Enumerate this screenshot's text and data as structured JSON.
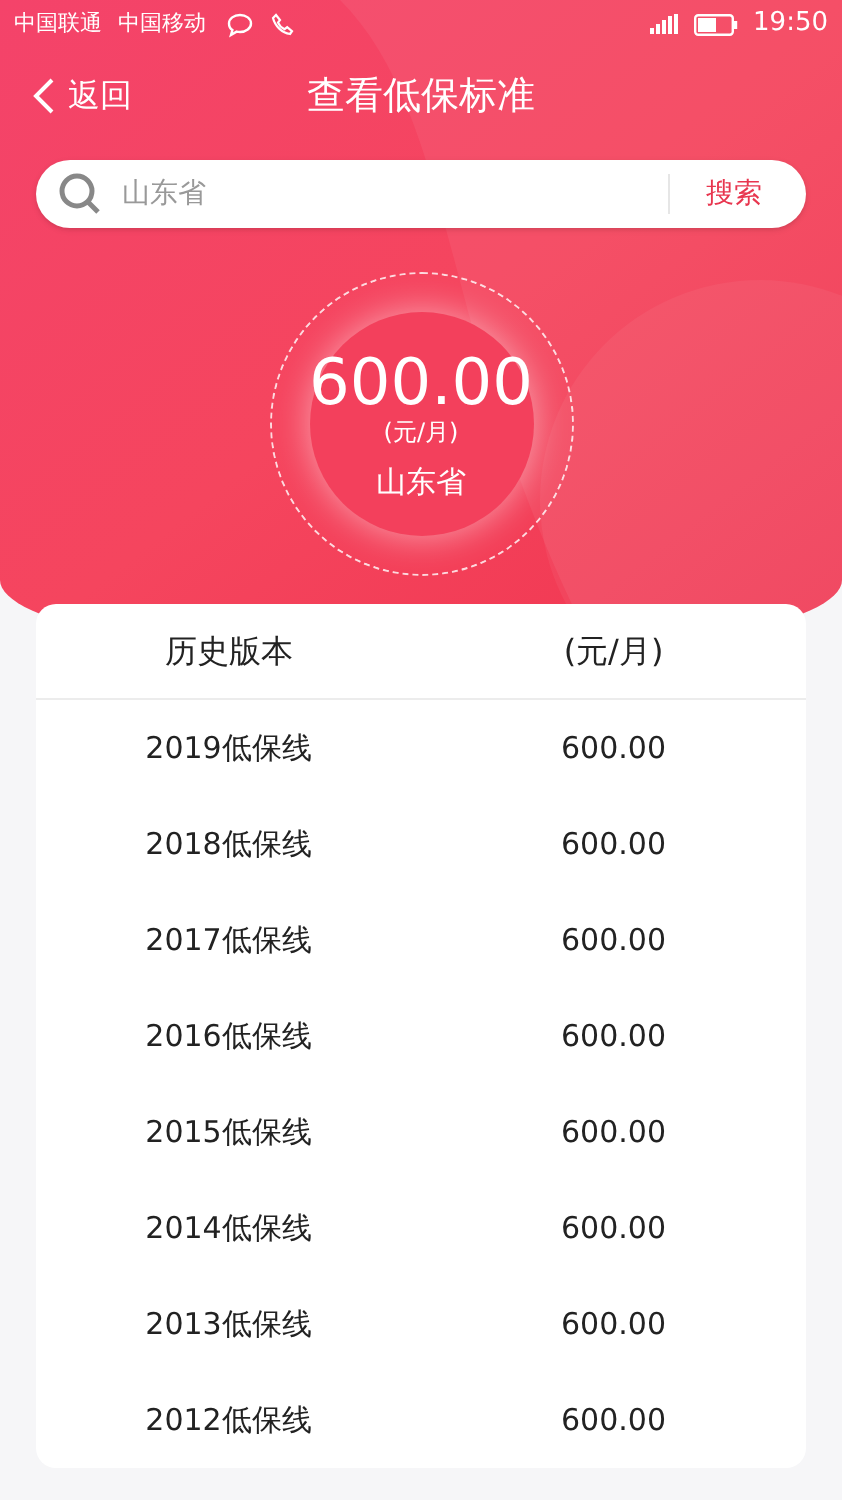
{
  "status_bar": {
    "carriers": [
      "中国联通",
      "中国移动"
    ],
    "time": "19:50"
  },
  "nav": {
    "back": "返回",
    "title": "查看低保标准"
  },
  "search": {
    "value": "山东省",
    "button": "搜索"
  },
  "summary": {
    "amount": "600.00",
    "unit": "(元/月)",
    "region": "山东省"
  },
  "table": {
    "columns": [
      "历史版本",
      "(元/月)"
    ],
    "rows": [
      [
        "2019低保线",
        "600.00"
      ],
      [
        "2018低保线",
        "600.00"
      ],
      [
        "2017低保线",
        "600.00"
      ],
      [
        "2016低保线",
        "600.00"
      ],
      [
        "2015低保线",
        "600.00"
      ],
      [
        "2014低保线",
        "600.00"
      ],
      [
        "2013低保线",
        "600.00"
      ],
      [
        "2012低保线",
        "600.00"
      ]
    ]
  }
}
